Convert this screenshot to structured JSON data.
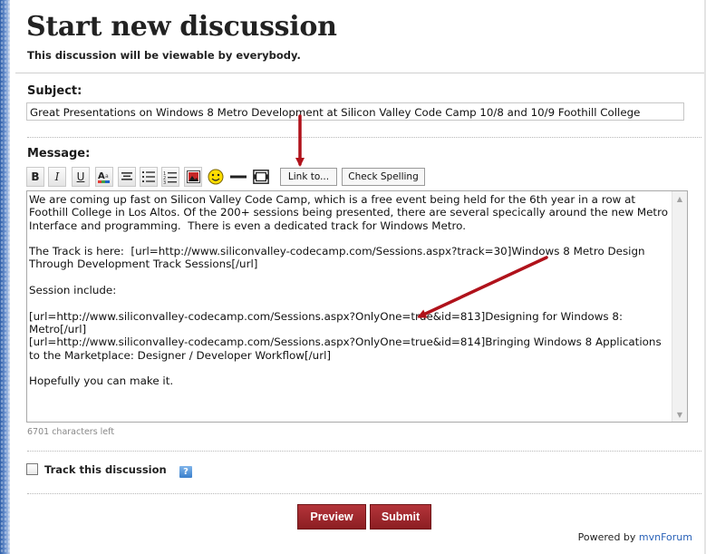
{
  "page": {
    "title": "Start new discussion",
    "subtitle": "This discussion will be viewable by everybody."
  },
  "subject": {
    "label": "Subject:",
    "value": "Great Presentations on Windows 8 Metro Development at Silicon Valley Code Camp 10/8 and 10/9 Foothill College"
  },
  "message": {
    "label": "Message:",
    "body": "We are coming up fast on Silicon Valley Code Camp, which is a free event being held for the 6th year in a row at Foothill College in Los Altos. Of the 200+ sessions being presented, there are several specically around the new Metro Interface and programming.  There is even a dedicated track for Windows Metro.\n\nThe Track is here:  [url=http://www.siliconvalley-codecamp.com/Sessions.aspx?track=30]Windows 8 Metro Design Through Development Track Sessions[/url]\n\nSession include:\n\n[url=http://www.siliconvalley-codecamp.com/Sessions.aspx?OnlyOne=true&id=813]Designing for Windows 8: Metro[/url]\n[url=http://www.siliconvalley-codecamp.com/Sessions.aspx?OnlyOne=true&id=814]Bringing Windows 8 Applications to the Marketplace: Designer / Developer Workflow[/url]\n\nHopefully you can make it.",
    "chars_left": "6701 characters left"
  },
  "toolbar": {
    "bold": "B",
    "italic": "I",
    "underline": "U",
    "link_button": "Link to...",
    "spell_button": "Check Spelling",
    "icons": [
      "bold-icon",
      "italic-icon",
      "underline-icon",
      "font-color-icon",
      "align-center-icon",
      "bulleted-list-icon",
      "numbered-list-icon",
      "image-icon",
      "smiley-icon",
      "horizontal-rule-icon",
      "media-icon"
    ]
  },
  "track": {
    "label": "Track this discussion",
    "checked": false,
    "help_glyph": "?"
  },
  "actions": {
    "preview_label": "Preview",
    "submit_label": "Submit"
  },
  "footer": {
    "powered_prefix": "Powered by",
    "brand": "mvnForum"
  },
  "colors": {
    "button_red": "#9b2227",
    "annotation_arrow": "#b0121b",
    "brand_link": "#2a62b8"
  }
}
